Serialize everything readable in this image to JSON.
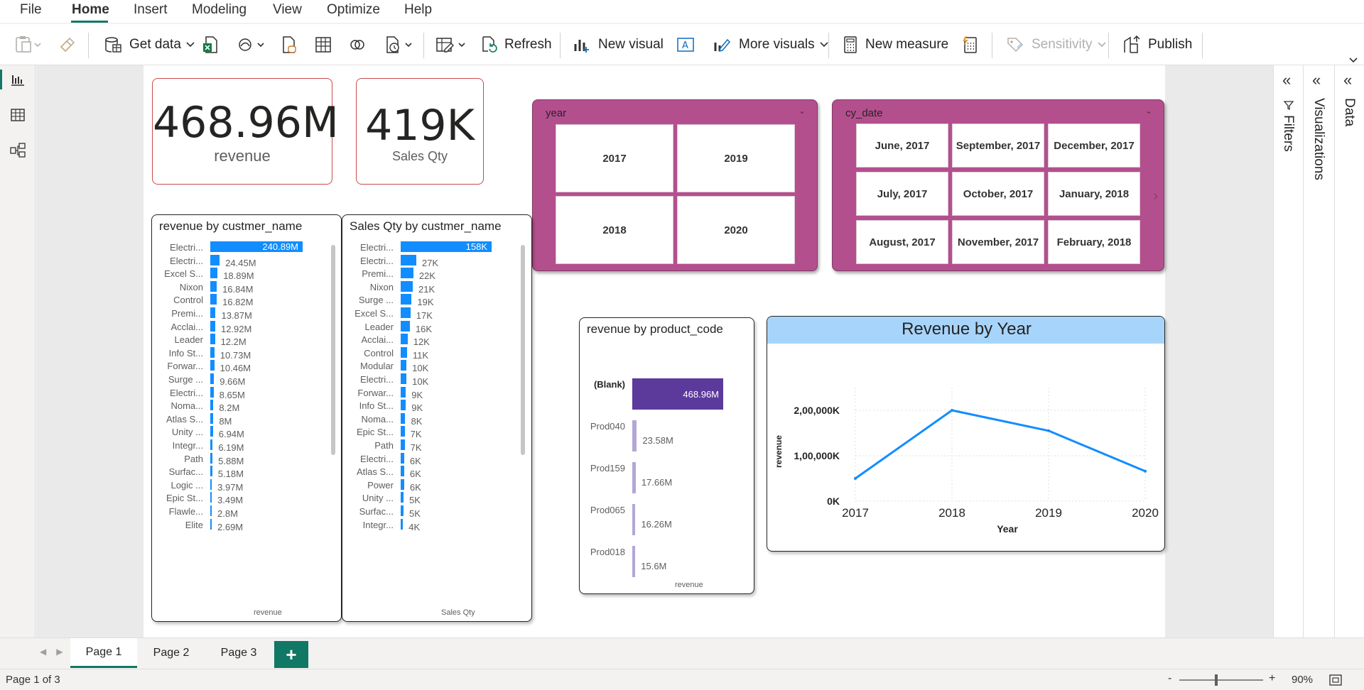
{
  "menu": {
    "items": [
      "File",
      "Home",
      "Insert",
      "Modeling",
      "View",
      "Optimize",
      "Help"
    ],
    "active": "Home"
  },
  "ribbon": {
    "get_data": "Get data",
    "refresh": "Refresh",
    "new_visual": "New visual",
    "more_visuals": "More visuals",
    "new_measure": "New measure",
    "sensitivity": "Sensitivity",
    "publish": "Publish"
  },
  "cards": [
    {
      "value": "468.96M",
      "label": "revenue"
    },
    {
      "value": "419K",
      "label": "Sales Qty"
    }
  ],
  "year_slicer": {
    "title": "year",
    "items": [
      "2017",
      "2019",
      "2018",
      "2020"
    ]
  },
  "date_slicer": {
    "title": "cy_date",
    "items": [
      "June, 2017",
      "September, 2017",
      "December, 2017",
      "July, 2017",
      "October, 2017",
      "January, 2018",
      "August, 2017",
      "November, 2017",
      "February, 2018"
    ]
  },
  "revenue_by_customer": {
    "title": "revenue by custmer_name",
    "axis_label": "revenue",
    "rows": [
      {
        "label": "Electri...",
        "value": 240.89,
        "display": "240.89M"
      },
      {
        "label": "Electri...",
        "value": 24.45,
        "display": "24.45M"
      },
      {
        "label": "Excel S...",
        "value": 18.89,
        "display": "18.89M"
      },
      {
        "label": "Nixon",
        "value": 16.84,
        "display": "16.84M"
      },
      {
        "label": "Control",
        "value": 16.82,
        "display": "16.82M"
      },
      {
        "label": "Premi...",
        "value": 13.87,
        "display": "13.87M"
      },
      {
        "label": "Acclai...",
        "value": 12.92,
        "display": "12.92M"
      },
      {
        "label": "Leader",
        "value": 12.2,
        "display": "12.2M"
      },
      {
        "label": "Info St...",
        "value": 10.73,
        "display": "10.73M"
      },
      {
        "label": "Forwar...",
        "value": 10.46,
        "display": "10.46M"
      },
      {
        "label": "Surge ...",
        "value": 9.66,
        "display": "9.66M"
      },
      {
        "label": "Electri...",
        "value": 8.65,
        "display": "8.65M"
      },
      {
        "label": "Noma...",
        "value": 8.2,
        "display": "8.2M"
      },
      {
        "label": "Atlas S...",
        "value": 8,
        "display": "8M"
      },
      {
        "label": "Unity ...",
        "value": 6.94,
        "display": "6.94M"
      },
      {
        "label": "Integr...",
        "value": 6.19,
        "display": "6.19M"
      },
      {
        "label": "Path",
        "value": 5.88,
        "display": "5.88M"
      },
      {
        "label": "Surfac...",
        "value": 5.18,
        "display": "5.18M"
      },
      {
        "label": "Logic ...",
        "value": 3.97,
        "display": "3.97M"
      },
      {
        "label": "Epic St...",
        "value": 3.49,
        "display": "3.49M"
      },
      {
        "label": "Flawle...",
        "value": 2.8,
        "display": "2.8M"
      },
      {
        "label": "Elite",
        "value": 2.69,
        "display": "2.69M"
      }
    ]
  },
  "qty_by_customer": {
    "title": "Sales Qty by custmer_name",
    "axis_label": "Sales Qty",
    "rows": [
      {
        "label": "Electri...",
        "value": 158,
        "display": "158K"
      },
      {
        "label": "Electri...",
        "value": 27,
        "display": "27K"
      },
      {
        "label": "Premi...",
        "value": 22,
        "display": "22K"
      },
      {
        "label": "Nixon",
        "value": 21,
        "display": "21K"
      },
      {
        "label": "Surge ...",
        "value": 19,
        "display": "19K"
      },
      {
        "label": "Excel S...",
        "value": 17,
        "display": "17K"
      },
      {
        "label": "Leader",
        "value": 16,
        "display": "16K"
      },
      {
        "label": "Acclai...",
        "value": 12,
        "display": "12K"
      },
      {
        "label": "Control",
        "value": 11,
        "display": "11K"
      },
      {
        "label": "Modular",
        "value": 10,
        "display": "10K"
      },
      {
        "label": "Electri...",
        "value": 10,
        "display": "10K"
      },
      {
        "label": "Forwar...",
        "value": 9,
        "display": "9K"
      },
      {
        "label": "Info St...",
        "value": 9,
        "display": "9K"
      },
      {
        "label": "Noma...",
        "value": 8,
        "display": "8K"
      },
      {
        "label": "Epic St...",
        "value": 7,
        "display": "7K"
      },
      {
        "label": "Path",
        "value": 7,
        "display": "7K"
      },
      {
        "label": "Electri...",
        "value": 6,
        "display": "6K"
      },
      {
        "label": "Atlas S...",
        "value": 6,
        "display": "6K"
      },
      {
        "label": "Power",
        "value": 6,
        "display": "6K"
      },
      {
        "label": "Unity ...",
        "value": 5,
        "display": "5K"
      },
      {
        "label": "Surfac...",
        "value": 5,
        "display": "5K"
      },
      {
        "label": "Integr...",
        "value": 4,
        "display": "4K"
      }
    ]
  },
  "revenue_by_product": {
    "title": "revenue by product_code",
    "axis_label": "revenue",
    "rows": [
      {
        "label": "(Blank)",
        "value": 468.96,
        "display": "468.96M"
      },
      {
        "label": "Prod040",
        "value": 23.58,
        "display": "23.58M"
      },
      {
        "label": "Prod159",
        "value": 17.66,
        "display": "17.66M"
      },
      {
        "label": "Prod065",
        "value": 16.26,
        "display": "16.26M"
      },
      {
        "label": "Prod018",
        "value": 15.6,
        "display": "15.6M"
      }
    ]
  },
  "chart_data": {
    "type": "line",
    "title": "Revenue by Year",
    "xlabel": "Year",
    "ylabel": "revenue",
    "x": [
      "2017",
      "2018",
      "2019",
      "2020"
    ],
    "series": [
      {
        "values": [
          50000,
          200000,
          155000,
          66000
        ]
      }
    ],
    "ylim": [
      0,
      250000
    ],
    "yticks": [
      0,
      100000,
      200000
    ],
    "ytick_labels": [
      "0K",
      "1,00,000K",
      "2,00,000K"
    ],
    "grid": true,
    "line_color": "#118dff",
    "title_bg": "#a7d4fb"
  },
  "panes": {
    "filters": "Filters",
    "visualizations": "Visualizations",
    "data": "Data"
  },
  "tabs": [
    "Page 1",
    "Page 2",
    "Page 3"
  ],
  "add_tab": "+",
  "status": {
    "page_info": "Page 1 of 3",
    "zoom": "90%"
  },
  "colors": {
    "accent": "#117865",
    "bar": "#118dff",
    "slicer_bg": "#b44f8e",
    "product_top_bar": "#5b3a9c",
    "product_bar": "#b4a7d6",
    "card_border": "#c94b4b"
  }
}
